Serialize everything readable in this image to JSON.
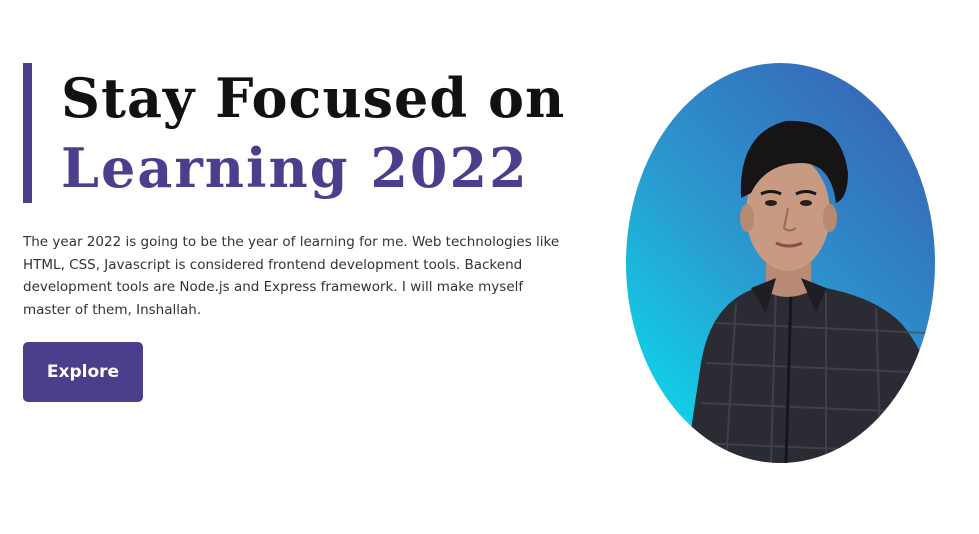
{
  "hero": {
    "title_line1": "Stay Focused on",
    "title_line2": "Learning 2022",
    "description": "The year 2022 is going to be the year of learning for me. Web technologies like HTML, CSS, Javascript is considered frontend development tools. Backend development tools are Node.js and Express framework. I will make myself master of them, Inshallah.",
    "button_label": "Explore"
  },
  "colors": {
    "accent": "#4b3f8d",
    "title_dark": "#111111",
    "gradient_start": "#06e6f0",
    "gradient_end": "#3a5ab0"
  }
}
